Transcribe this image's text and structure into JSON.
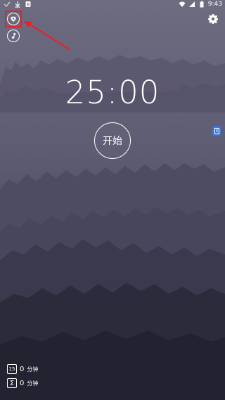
{
  "status_bar": {
    "time": "9:43",
    "left_icons": [
      "check-icon",
      "download-icon",
      "notification-icon"
    ],
    "right_icons": [
      "wifi-icon",
      "signal-icon",
      "battery-icon"
    ]
  },
  "top_left": {
    "theme_icon": "theme-icon",
    "music_icon": "music-note-icon",
    "highlight_color": "#e8202a"
  },
  "top_right": {
    "settings_icon": "gear-icon"
  },
  "timer": {
    "display": "25:00"
  },
  "start_button": {
    "label": "开始"
  },
  "side_tab": {
    "icon": "note-icon",
    "color": "#3a78d6"
  },
  "stats": {
    "today": {
      "icon_text": "15",
      "value": "0",
      "unit": "分钟"
    },
    "total": {
      "icon_text": "Σ",
      "value": "0",
      "unit": "分钟"
    }
  }
}
